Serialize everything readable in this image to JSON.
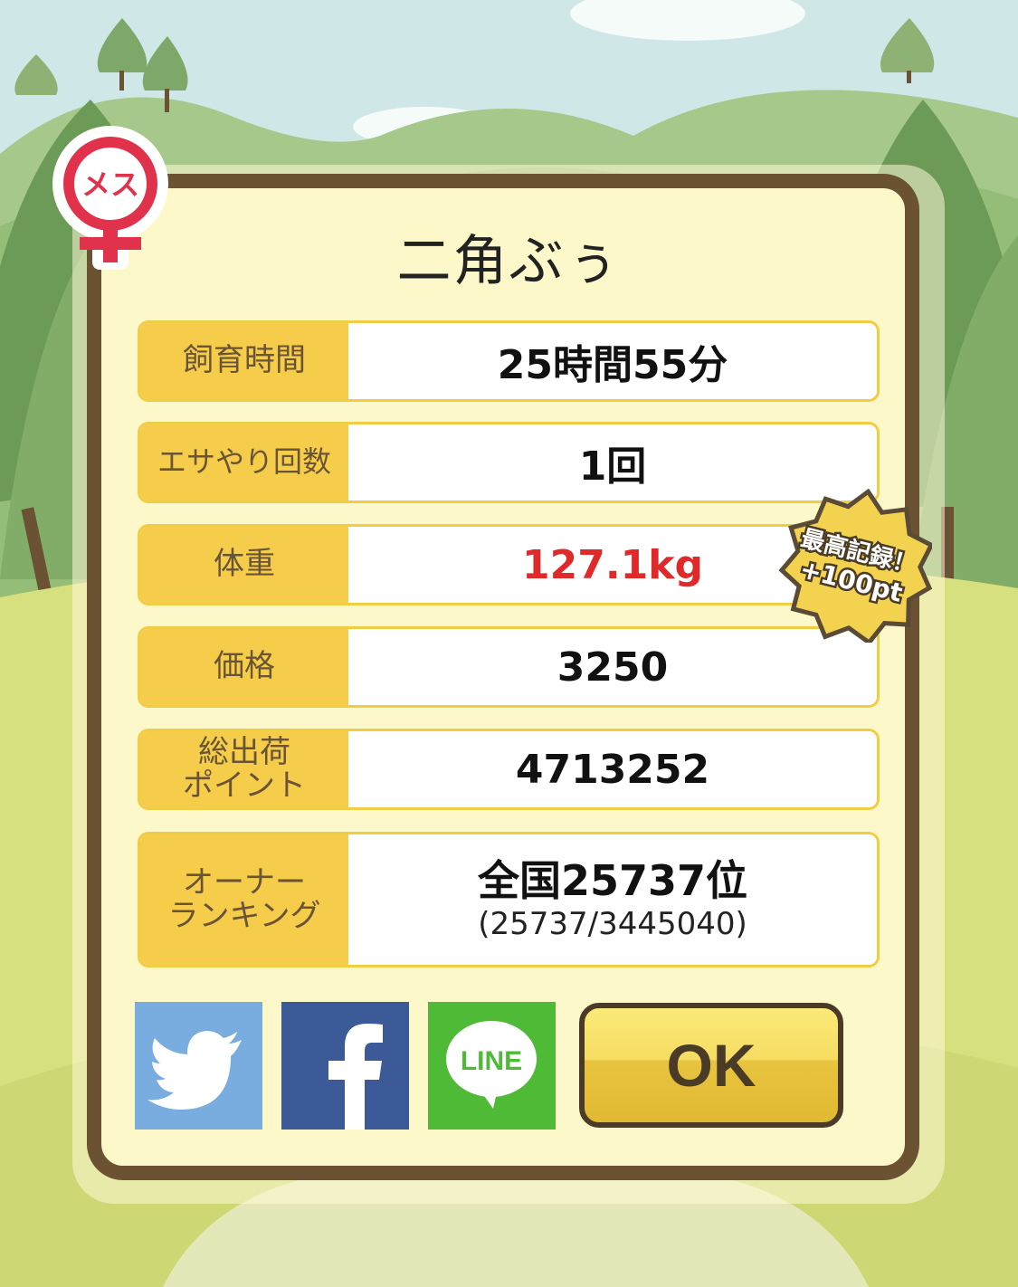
{
  "gender_badge": {
    "label": "メス",
    "color": "#e0324a"
  },
  "pig": {
    "name": "二角ぶぅ"
  },
  "stats": {
    "breeding_time": {
      "label": "飼育時間",
      "value": "25時間55分"
    },
    "feed_count": {
      "label": "エサやり回数",
      "value": "1回"
    },
    "weight": {
      "label": "体重",
      "value": "127.1kg"
    },
    "price": {
      "label": "価格",
      "value": "3250"
    },
    "total_shipping_points": {
      "label": "総出荷\nポイント",
      "value": "4713252"
    },
    "owner_ranking": {
      "label": "オーナー\nランキング",
      "value": "全国25737位",
      "detail": "(25737/3445040)"
    }
  },
  "record_badge": {
    "line1": "最高記録！",
    "line2": "+100pt"
  },
  "share": {
    "twitter_icon": "twitter-bird-icon",
    "facebook_icon": "facebook-f-icon",
    "line_icon": "line-bubble-icon",
    "line_text": "LINE"
  },
  "ok_button": {
    "label": "OK"
  },
  "colors": {
    "label_bg": "#f5cd4b",
    "panel_border": "#6b5233",
    "panel_bg": "#fdf8c9",
    "weight_value": "#e02a2a",
    "twitter": "#79acdf",
    "facebook": "#3c5a98",
    "line": "#4fba35"
  }
}
